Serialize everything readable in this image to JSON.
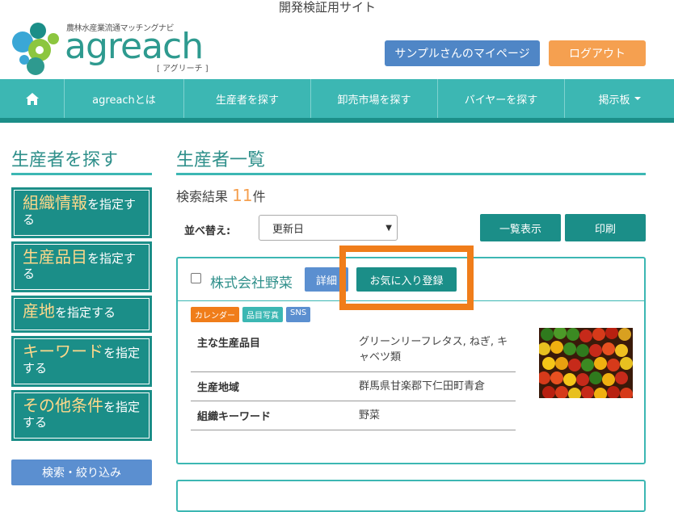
{
  "site_label": "開発検証用サイト",
  "logo": {
    "tagline": "農林水産業流通マッチングナビ",
    "word": "agreach",
    "sub": "[ アグリーチ ]"
  },
  "header": {
    "mypage_label": "サンプルさんのマイページ",
    "logout_label": "ログアウト"
  },
  "nav": {
    "home_icon": "home-icon",
    "items": [
      "agreachとは",
      "生産者を探す",
      "卸売市場を探す",
      "バイヤーを探す",
      "掲示板"
    ]
  },
  "sidebar": {
    "title": "生産者を探す",
    "filters": [
      {
        "big": "組織情報",
        "rest": "を指定する"
      },
      {
        "big": "生産品目",
        "rest": "を指定する"
      },
      {
        "big": "産地",
        "rest": "を指定する"
      },
      {
        "big": "キーワード",
        "rest": "を指定する"
      },
      {
        "big": "その他条件",
        "rest": "を指定する"
      }
    ],
    "search_label": "検索・絞り込み"
  },
  "main": {
    "title": "生産者一覧",
    "result_prefix": "検索結果",
    "result_count": "11",
    "result_suffix": "件",
    "sort_label": "並べ替え:",
    "sort_value": "更新日",
    "list_view_label": "一覧表示",
    "print_label": "印刷"
  },
  "card": {
    "company": "株式会社野菜",
    "detail_label": "詳細",
    "favorite_label": "お気に入り登録",
    "badges": [
      "カレンダー",
      "品目写真",
      "SNS"
    ],
    "rows": [
      {
        "key": "主な生産品目",
        "value": "グリーンリーフレタス, ねぎ, キャベツ類"
      },
      {
        "key": "生産地域",
        "value": "群馬県甘楽郡下仁田町青倉"
      },
      {
        "key": "組織キーワード",
        "value": "野菜"
      }
    ]
  },
  "colors": {
    "teal": "#3cb7b3",
    "dark_teal": "#1b8e88",
    "blue": "#5b8fd0",
    "orange": "#f5a050",
    "highlight": "#f07d1a"
  }
}
